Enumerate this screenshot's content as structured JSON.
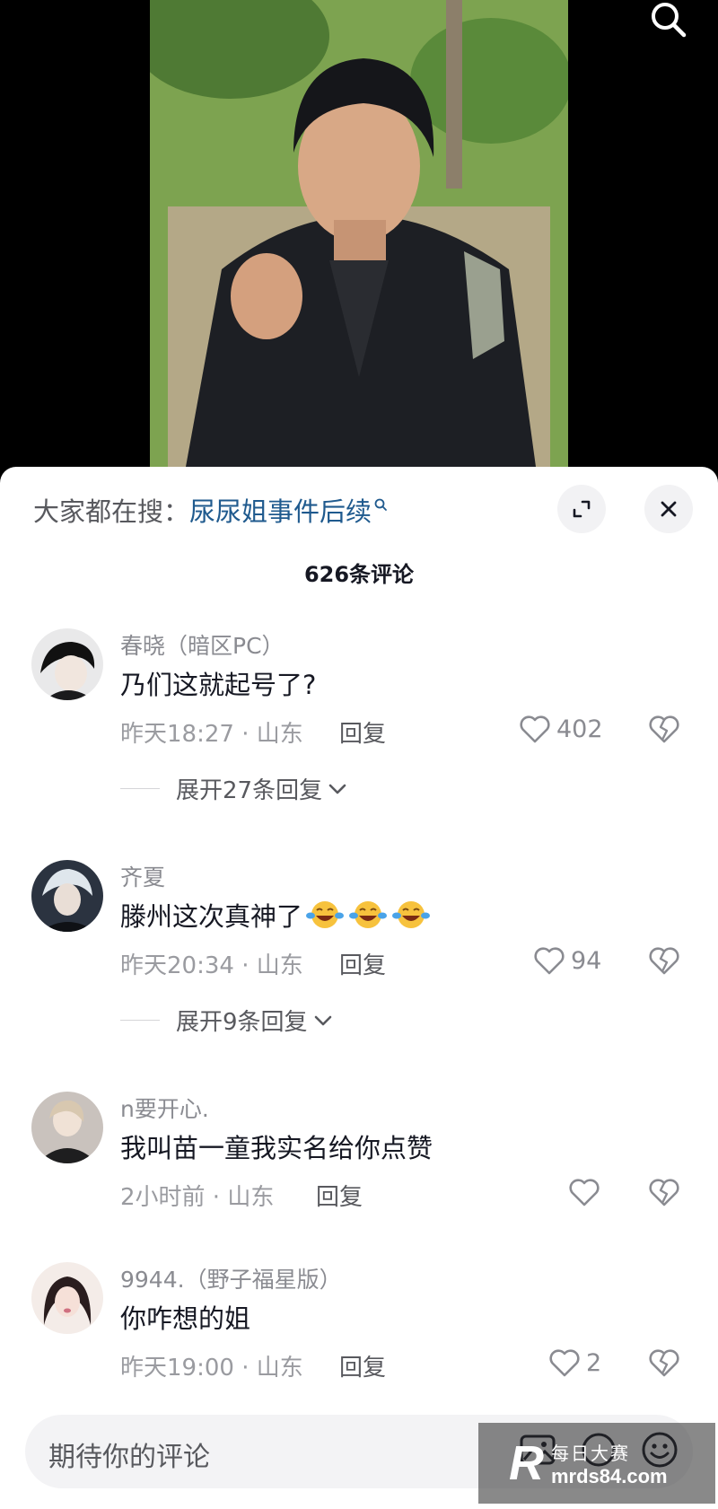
{
  "video": {
    "search_icon": "search-icon"
  },
  "sheet": {
    "search_prefix": "大家都在搜：",
    "search_keyword": "尿尿姐事件后续",
    "comment_count": "626条评论"
  },
  "comments": [
    {
      "username": "春晓（暗区PC）",
      "content": "乃们这就起号了?",
      "time_location": "昨天18:27 · 山东",
      "reply_label": "回复",
      "likes": "402",
      "expand_label": "展开27条回复"
    },
    {
      "username": "齐夏",
      "content": "滕州这次真神了",
      "emoji": "tears-of-joy-emoji",
      "time_location": "昨天20:34 · 山东",
      "reply_label": "回复",
      "likes": "94",
      "expand_label": "展开9条回复"
    },
    {
      "username": "n要开心.",
      "content": "我叫苗一童我实名给你点赞",
      "time_location": "2小时前 · 山东",
      "reply_label": "回复",
      "likes": ""
    },
    {
      "username": "9944.（野子福星版）",
      "content": "你咋想的姐",
      "time_location": "昨天19:00 · 山东",
      "reply_label": "回复",
      "likes": "2"
    }
  ],
  "input": {
    "placeholder": "期待你的评论"
  },
  "watermark": {
    "logo": "R",
    "line1": "每日大赛",
    "line2": "mrds84.com"
  }
}
